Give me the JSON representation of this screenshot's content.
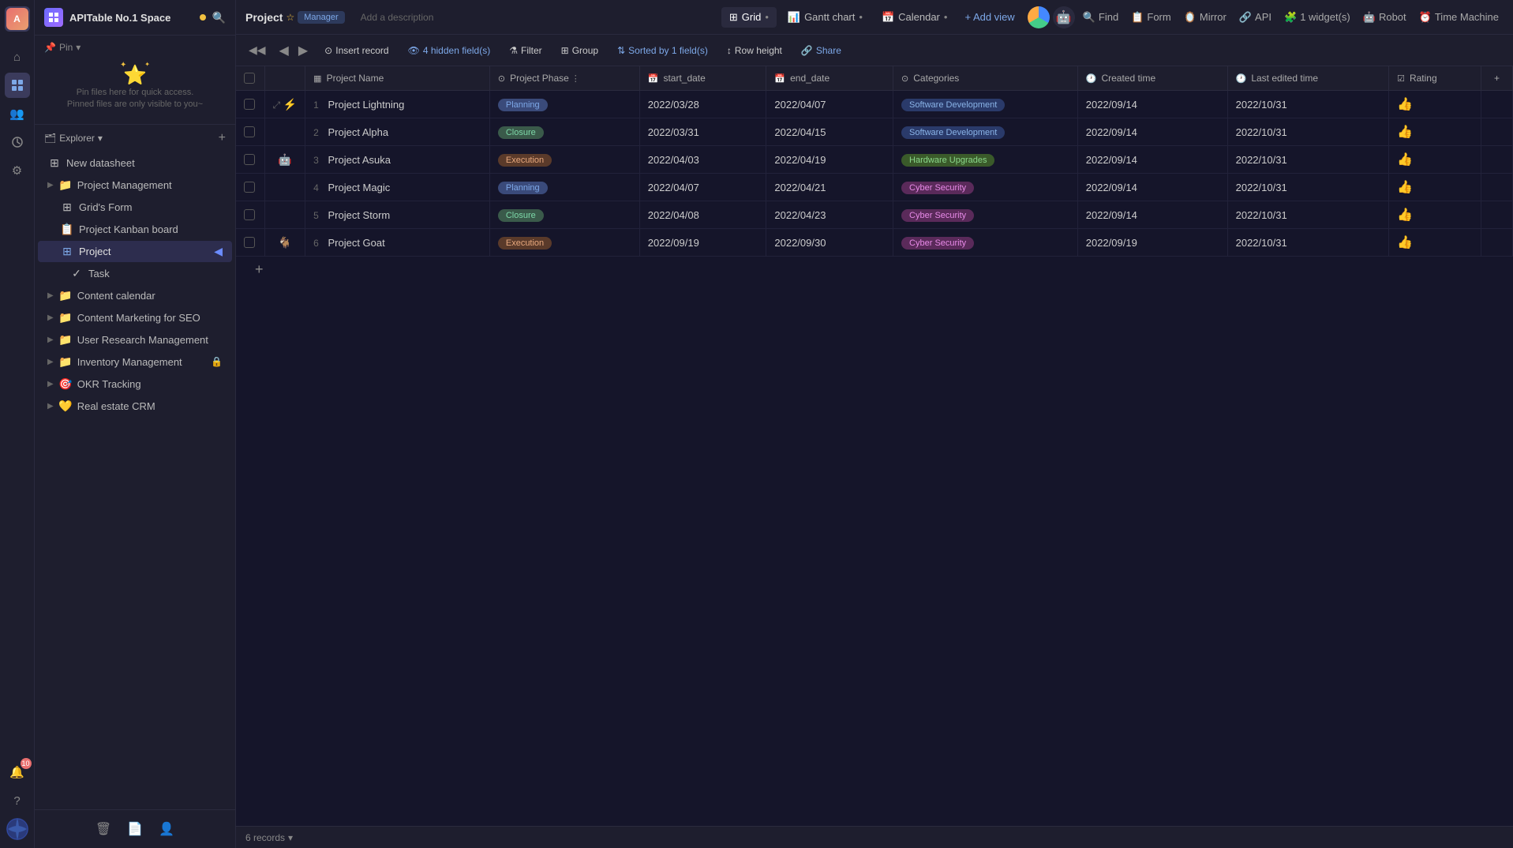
{
  "app": {
    "workspace": "APITable No.1 Space",
    "workspace_dot_color": "#f0c040",
    "project_name": "Project",
    "manager_label": "Manager",
    "description_placeholder": "Add a description"
  },
  "views": {
    "tabs": [
      {
        "id": "grid",
        "label": "Grid",
        "icon": "⊞",
        "active": true
      },
      {
        "id": "gantt",
        "label": "Gantt chart",
        "icon": "📊"
      },
      {
        "id": "calendar",
        "label": "Calendar",
        "icon": "📅"
      }
    ],
    "add_view": "+ Add view"
  },
  "toolbar": {
    "insert_record": "Insert record",
    "hidden_fields": "4 hidden field(s)",
    "filter": "Filter",
    "group": "Group",
    "sorted": "Sorted by 1 field(s)",
    "row_height": "Row height",
    "share": "Share",
    "find": "Find",
    "form": "Form",
    "mirror": "Mirror",
    "api": "API",
    "widget": "1 widget(s)",
    "robot": "Robot",
    "time_machine": "Time Machine"
  },
  "columns": [
    {
      "id": "name",
      "label": "Project Name",
      "icon": "▦"
    },
    {
      "id": "phase",
      "label": "Project Phase",
      "icon": "⊙"
    },
    {
      "id": "start_date",
      "label": "start_date",
      "icon": "📅"
    },
    {
      "id": "end_date",
      "label": "end_date",
      "icon": "📅"
    },
    {
      "id": "categories",
      "label": "Categories",
      "icon": "⊙"
    },
    {
      "id": "created_time",
      "label": "Created time",
      "icon": "🕐"
    },
    {
      "id": "last_edited",
      "label": "Last edited time",
      "icon": "🕐"
    },
    {
      "id": "rating",
      "label": "Rating",
      "icon": "☑"
    }
  ],
  "rows": [
    {
      "num": 1,
      "name": "Project Lightning",
      "phase": "Planning",
      "phase_type": "planning",
      "start_date": "2022/03/28",
      "end_date": "2022/04/07",
      "category": "Software Development",
      "cat_type": "software",
      "created_time": "2022/09/14",
      "last_edited": "2022/10/31",
      "rating": "👍",
      "has_expand": true,
      "has_icon": true,
      "icon": "⚡"
    },
    {
      "num": 2,
      "name": "Project Alpha",
      "phase": "Closure",
      "phase_type": "closure",
      "start_date": "2022/03/31",
      "end_date": "2022/04/15",
      "category": "Software Development",
      "cat_type": "software",
      "created_time": "2022/09/14",
      "last_edited": "2022/10/31",
      "rating": "👍",
      "has_expand": false,
      "has_icon": false
    },
    {
      "num": 3,
      "name": "Project Asuka",
      "phase": "Execution",
      "phase_type": "execution",
      "start_date": "2022/04/03",
      "end_date": "2022/04/19",
      "category": "Hardware Upgrades",
      "cat_type": "hardware",
      "created_time": "2022/09/14",
      "last_edited": "2022/10/31",
      "rating": "👍",
      "has_expand": false,
      "has_icon": true,
      "icon": "🤖"
    },
    {
      "num": 4,
      "name": "Project Magic",
      "phase": "Planning",
      "phase_type": "planning",
      "start_date": "2022/04/07",
      "end_date": "2022/04/21",
      "category": "Cyber Security",
      "cat_type": "cyber",
      "created_time": "2022/09/14",
      "last_edited": "2022/10/31",
      "rating": "👍",
      "has_expand": false,
      "has_icon": false
    },
    {
      "num": 5,
      "name": "Project Storm",
      "phase": "Closure",
      "phase_type": "closure",
      "start_date": "2022/04/08",
      "end_date": "2022/04/23",
      "category": "Cyber Security",
      "cat_type": "cyber",
      "created_time": "2022/09/14",
      "last_edited": "2022/10/31",
      "rating": "👍",
      "has_expand": false,
      "has_icon": false
    },
    {
      "num": 6,
      "name": "Project Goat",
      "phase": "Execution",
      "phase_type": "execution",
      "start_date": "2022/09/19",
      "end_date": "2022/09/30",
      "category": "Cyber Security",
      "cat_type": "cyber",
      "created_time": "2022/09/19",
      "last_edited": "2022/10/31",
      "rating": "👍",
      "has_expand": false,
      "has_icon": true,
      "icon": "🐐"
    }
  ],
  "status": {
    "records_count": "6 records",
    "records_arrow": "▾"
  },
  "sidebar": {
    "new_datasheet": "New datasheet",
    "project_management": "Project Management",
    "grids_form": "Grid's Form",
    "project_kanban": "Project Kanban board",
    "project": "Project",
    "task": "Task",
    "content_calendar": "Content calendar",
    "content_marketing": "Content Marketing for SEO",
    "user_research": "User Research Management",
    "inventory_management": "Inventory Management",
    "okr_tracking": "OKR Tracking",
    "real_estate": "Real estate CRM",
    "pin_label": "Pin",
    "explorer_label": "Explorer",
    "pin_hint1": "Pin files here for quick access.",
    "pin_hint2": "Pinned files are only visible to you~"
  },
  "icons": {
    "home": "⌂",
    "search": "🔍",
    "bell": "🔔",
    "help": "?",
    "settings": "⚙",
    "members": "👥",
    "notifications_count": "10"
  }
}
